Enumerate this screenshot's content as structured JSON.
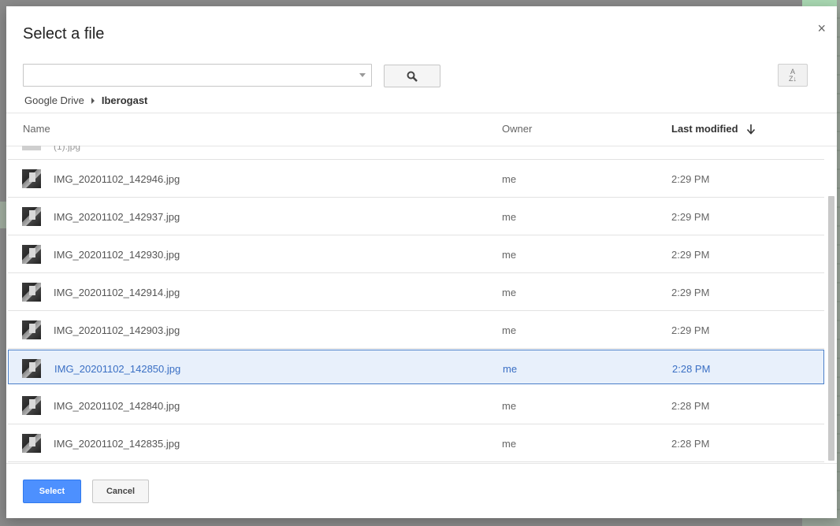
{
  "dialog": {
    "title": "Select a file",
    "close_label": "×"
  },
  "search": {
    "value": "",
    "placeholder": ""
  },
  "sort_toggle": {
    "icon": "sort-az-icon"
  },
  "breadcrumb": {
    "root": "Google Drive",
    "current": "Iberogast"
  },
  "columns": {
    "name": "Name",
    "owner": "Owner",
    "last_modified": "Last modified"
  },
  "partial_row": {
    "name": "(1).jpg"
  },
  "files": [
    {
      "name": "IMG_20201102_142946.jpg",
      "owner": "me",
      "modified": "2:29 PM",
      "selected": false
    },
    {
      "name": "IMG_20201102_142937.jpg",
      "owner": "me",
      "modified": "2:29 PM",
      "selected": false
    },
    {
      "name": "IMG_20201102_142930.jpg",
      "owner": "me",
      "modified": "2:29 PM",
      "selected": false
    },
    {
      "name": "IMG_20201102_142914.jpg",
      "owner": "me",
      "modified": "2:29 PM",
      "selected": false
    },
    {
      "name": "IMG_20201102_142903.jpg",
      "owner": "me",
      "modified": "2:29 PM",
      "selected": false
    },
    {
      "name": "IMG_20201102_142850.jpg",
      "owner": "me",
      "modified": "2:28 PM",
      "selected": true
    },
    {
      "name": "IMG_20201102_142840.jpg",
      "owner": "me",
      "modified": "2:28 PM",
      "selected": false
    },
    {
      "name": "IMG_20201102_142835.jpg",
      "owner": "me",
      "modified": "2:28 PM",
      "selected": false
    }
  ],
  "footer": {
    "select_label": "Select",
    "cancel_label": "Cancel"
  },
  "colors": {
    "primary": "#4d90fe",
    "selected_bg": "#e8f0fb",
    "selected_text": "#3a6fc4"
  }
}
